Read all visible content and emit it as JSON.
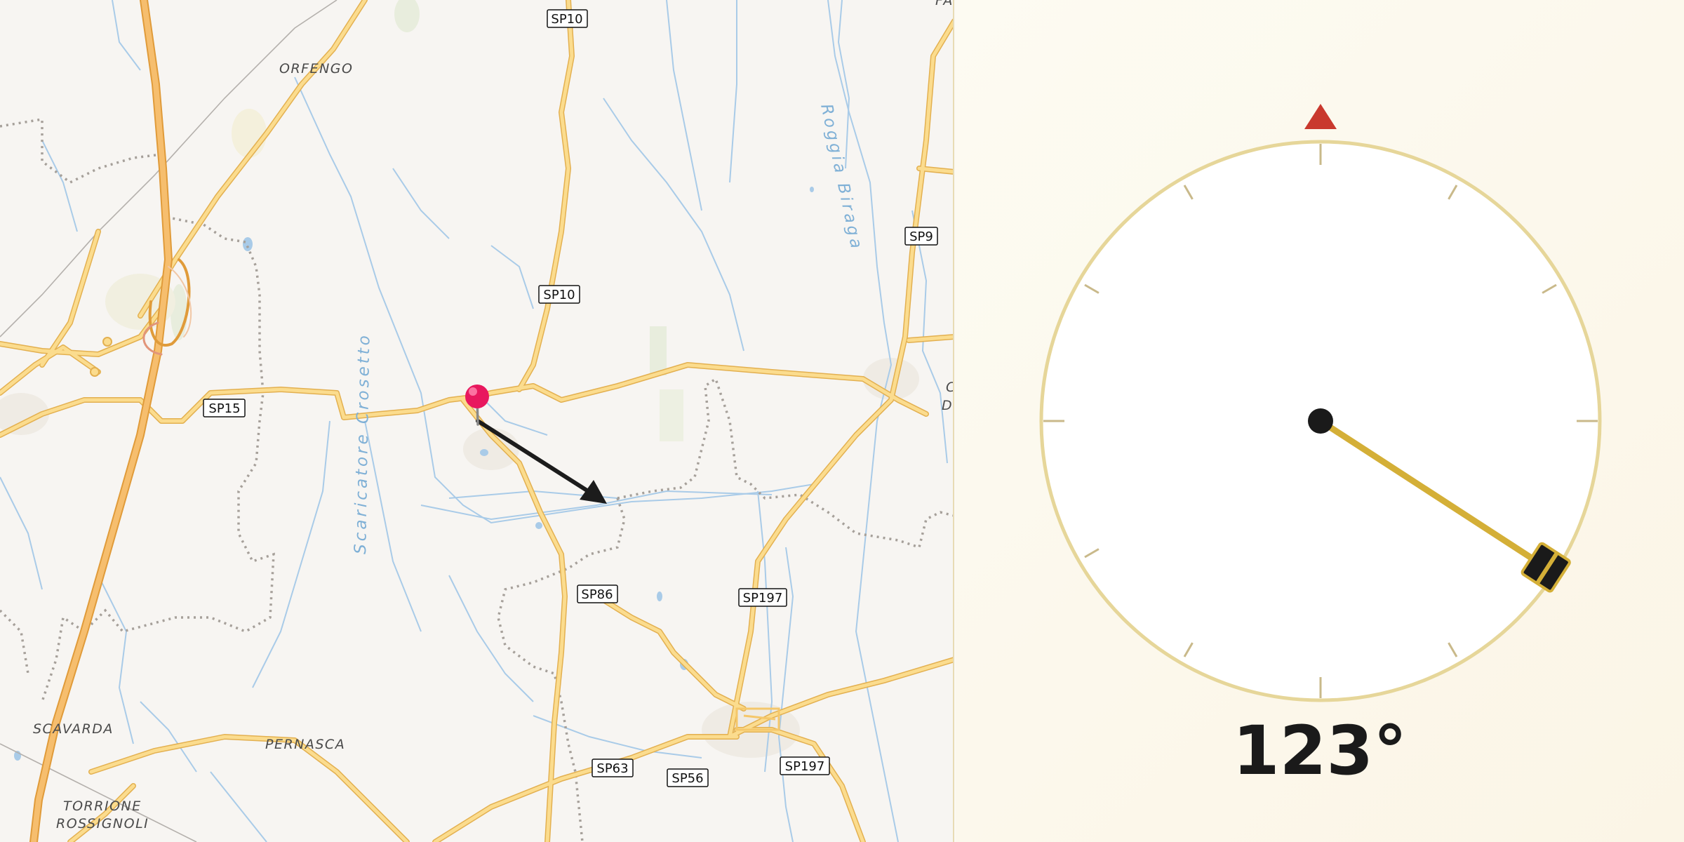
{
  "map": {
    "place_labels": [
      "ORFENGO",
      "SCAVARDA",
      "PERNASCA",
      "TORRIONE",
      "ROSSIGNOLI",
      "FA",
      "C",
      "D"
    ],
    "river_labels": [
      "Scaricatore Crosetto",
      "Roggia Biraga"
    ],
    "road_shields": [
      "SP10",
      "SP10",
      "SP9",
      "SP15",
      "SP86",
      "SP197",
      "SP63",
      "SP56",
      "SP197"
    ],
    "pin_icon": "map-pin-icon",
    "direction_arrow_icon": "arrow-icon",
    "colors": {
      "road": "#f5c76a",
      "road_casing": "#e3b050",
      "motorway": "#f0b25f",
      "water": "#a9cbe8",
      "boundary": "#a6a09a",
      "pin": "#e8185e",
      "arrow": "#1c1c1c"
    }
  },
  "compass": {
    "heading_text": "123°",
    "bearing_deg": 123,
    "north_marker_icon": "north-triangle-icon",
    "colors": {
      "ring": "#e6d699",
      "needle": "#d4af37",
      "north_marker": "#c9392e",
      "pivot": "#1a1a1a"
    }
  }
}
